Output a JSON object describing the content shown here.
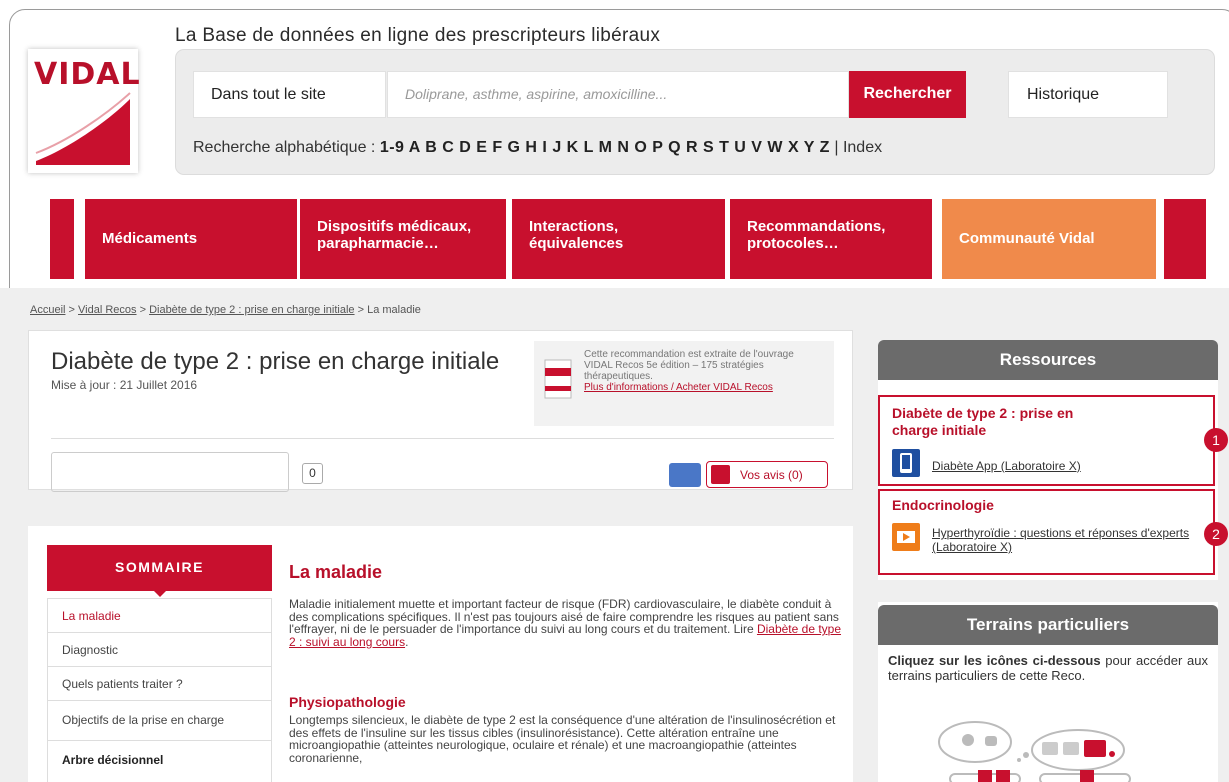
{
  "header": {
    "tagline": "La Base de données en ligne des prescripteurs libéraux",
    "logo": "VIDAL",
    "scope": "Dans tout le site",
    "search_placeholder": "Doliprane, asthme, aspirine, amoxicilline...",
    "search_button": "Rechercher",
    "history_button": "Historique",
    "alpha_label": "Recherche alphabétique :",
    "alpha_letters": "1-9 A B C D E F G H I J K L M N O P Q R S T U V W X Y Z",
    "index_sep": " | ",
    "index_link": "Index"
  },
  "nav": [
    {
      "label": "Médicaments"
    },
    {
      "label": "Dispositifs médicaux, parapharmacie…"
    },
    {
      "label": "Interactions, équivalences"
    },
    {
      "label": "Recommandations, protocoles…"
    },
    {
      "label": "Communauté Vidal"
    }
  ],
  "breadcrumb": {
    "items": [
      "Accueil",
      "Vidal Recos",
      "Diabète de type 2 : prise en charge initiale"
    ],
    "current": "La maladie",
    "sep": " > "
  },
  "title_card": {
    "title": "Diabète de type 2 : prise en charge initiale",
    "update": "Mise à jour : 21 Juillet 2016",
    "book_text": "Cette recommandation est extraite de l'ouvrage VIDAL Recos 5e édition – 175 stratégies thérapeutiques.",
    "book_link": "Plus d'informations / Acheter VIDAL Recos",
    "count": "0",
    "avis_button": "Vos avis (0)"
  },
  "resources": {
    "header": "Ressources",
    "box1_title": "Diabète de type 2 : prise en charge initiale",
    "box1_link": "Diabète App (Laboratoire X)",
    "box2_title": "Endocrinologie",
    "box2_link": "Hyperthyroïdie : questions et réponses d'experts (Laboratoire X)",
    "badge1": "1",
    "badge2": "2"
  },
  "terrains": {
    "header": "Terrains particuliers",
    "text_bold": "Cliquez sur les icônes ci-dessous",
    "text_rest": " pour accéder aux terrains particuliers de cette Reco."
  },
  "sommaire": {
    "header": "SOMMAIRE",
    "items": [
      "La maladie",
      "Diagnostic",
      "Quels patients traiter ?",
      "Objectifs de la prise en charge",
      "Arbre décisionnel"
    ]
  },
  "article": {
    "h1": "La maladie",
    "p1": "Maladie initialement muette et important facteur de risque (FDR) cardiovasculaire, le diabète conduit à des complications spécifiques. Il n'est pas toujours aisé de faire comprendre les risques au patient sans l'effrayer, ni de le persuader de l'importance du suivi au long cours et du traitement. Lire ",
    "p1_link": "Diabète de type 2 : suivi au long cours",
    "p1_end": ".",
    "h2": "Physiopathologie",
    "p2": "Longtemps silencieux, le diabète de type 2 est la conséquence d'une altération de l'insulinosécrétion et des effets de l'insuline sur les tissus cibles (insulinorésistance). Cette altération entraîne une microangiopathie (atteintes neurologique, oculaire et rénale) et une macroangiopathie (atteintes coronarienne,"
  }
}
